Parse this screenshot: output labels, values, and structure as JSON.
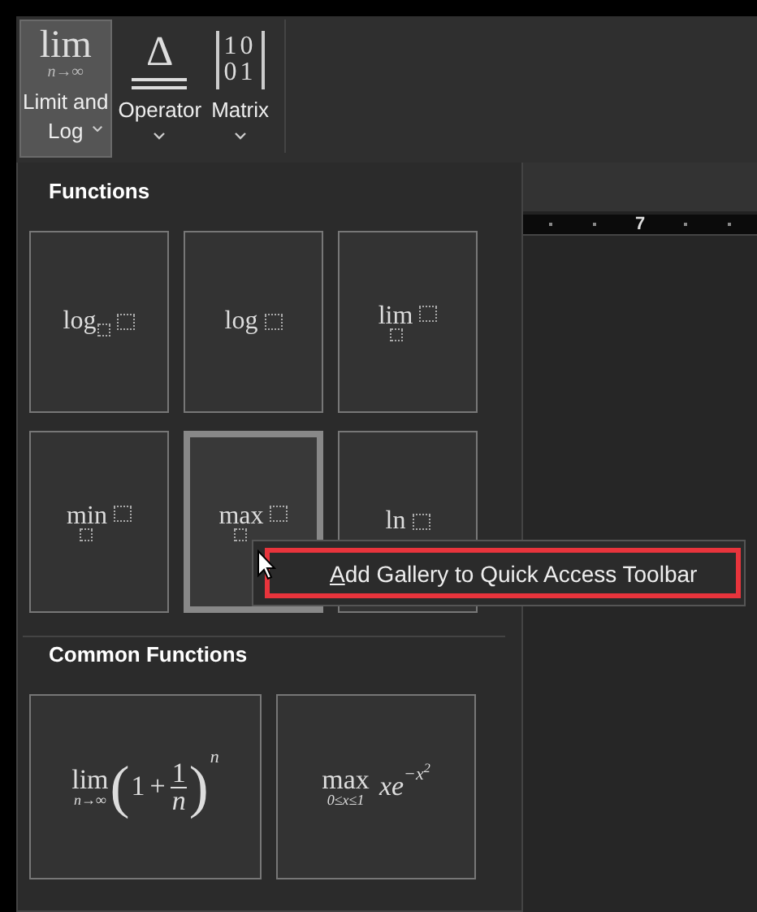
{
  "ribbon": {
    "buttons": [
      {
        "kind": "limit",
        "icon_text": "lim",
        "icon_sub": "n→∞",
        "label_lines": [
          "Limit and",
          "Log"
        ],
        "selected": true
      },
      {
        "kind": "operator",
        "icon_text": "Δ",
        "label_lines": [
          "Operator"
        ],
        "selected": false
      },
      {
        "kind": "matrix",
        "icon_rows": [
          "10",
          "01"
        ],
        "label_lines": [
          "Matrix"
        ],
        "selected": false
      }
    ]
  },
  "ruler": {
    "label": "7"
  },
  "gallery": {
    "sections": [
      {
        "title": "Functions",
        "items": [
          {
            "kind": "subscript",
            "op": "log",
            "selected": false
          },
          {
            "kind": "plain",
            "op": "log",
            "selected": false
          },
          {
            "kind": "under",
            "op": "lim",
            "selected": false
          },
          {
            "kind": "under",
            "op": "min",
            "selected": false
          },
          {
            "kind": "under",
            "op": "max",
            "selected": true
          },
          {
            "kind": "plain",
            "op": "ln",
            "selected": false
          }
        ]
      },
      {
        "title": "Common Functions",
        "items": [
          {
            "kind": "limit-fraction",
            "op": "lim",
            "under": "n→∞",
            "open": "(",
            "base": "1",
            "sign": "+",
            "numerator": "1",
            "denominator": "n",
            "close": ")",
            "power": "n",
            "selected": false
          },
          {
            "kind": "max-exp",
            "op": "max",
            "under": "0≤x≤1",
            "body": "xe",
            "power": "−x",
            "power_exp": "2",
            "selected": false
          }
        ]
      }
    ]
  },
  "context_menu": {
    "items": [
      {
        "access_key": "A",
        "label_rest": "dd Gallery to Quick Access Toolbar",
        "annotated": true
      }
    ]
  }
}
